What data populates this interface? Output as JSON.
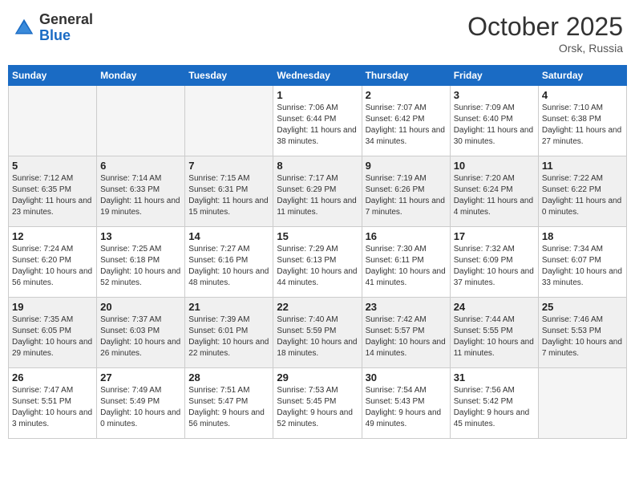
{
  "header": {
    "logo_general": "General",
    "logo_blue": "Blue",
    "month": "October 2025",
    "location": "Orsk, Russia"
  },
  "weekdays": [
    "Sunday",
    "Monday",
    "Tuesday",
    "Wednesday",
    "Thursday",
    "Friday",
    "Saturday"
  ],
  "weeks": [
    [
      {
        "day": "",
        "sunrise": "",
        "sunset": "",
        "daylight": "",
        "empty": true
      },
      {
        "day": "",
        "sunrise": "",
        "sunset": "",
        "daylight": "",
        "empty": true
      },
      {
        "day": "",
        "sunrise": "",
        "sunset": "",
        "daylight": "",
        "empty": true
      },
      {
        "day": "1",
        "sunrise": "Sunrise: 7:06 AM",
        "sunset": "Sunset: 6:44 PM",
        "daylight": "Daylight: 11 hours and 38 minutes."
      },
      {
        "day": "2",
        "sunrise": "Sunrise: 7:07 AM",
        "sunset": "Sunset: 6:42 PM",
        "daylight": "Daylight: 11 hours and 34 minutes."
      },
      {
        "day": "3",
        "sunrise": "Sunrise: 7:09 AM",
        "sunset": "Sunset: 6:40 PM",
        "daylight": "Daylight: 11 hours and 30 minutes."
      },
      {
        "day": "4",
        "sunrise": "Sunrise: 7:10 AM",
        "sunset": "Sunset: 6:38 PM",
        "daylight": "Daylight: 11 hours and 27 minutes."
      }
    ],
    [
      {
        "day": "5",
        "sunrise": "Sunrise: 7:12 AM",
        "sunset": "Sunset: 6:35 PM",
        "daylight": "Daylight: 11 hours and 23 minutes."
      },
      {
        "day": "6",
        "sunrise": "Sunrise: 7:14 AM",
        "sunset": "Sunset: 6:33 PM",
        "daylight": "Daylight: 11 hours and 19 minutes."
      },
      {
        "day": "7",
        "sunrise": "Sunrise: 7:15 AM",
        "sunset": "Sunset: 6:31 PM",
        "daylight": "Daylight: 11 hours and 15 minutes."
      },
      {
        "day": "8",
        "sunrise": "Sunrise: 7:17 AM",
        "sunset": "Sunset: 6:29 PM",
        "daylight": "Daylight: 11 hours and 11 minutes."
      },
      {
        "day": "9",
        "sunrise": "Sunrise: 7:19 AM",
        "sunset": "Sunset: 6:26 PM",
        "daylight": "Daylight: 11 hours and 7 minutes."
      },
      {
        "day": "10",
        "sunrise": "Sunrise: 7:20 AM",
        "sunset": "Sunset: 6:24 PM",
        "daylight": "Daylight: 11 hours and 4 minutes."
      },
      {
        "day": "11",
        "sunrise": "Sunrise: 7:22 AM",
        "sunset": "Sunset: 6:22 PM",
        "daylight": "Daylight: 11 hours and 0 minutes."
      }
    ],
    [
      {
        "day": "12",
        "sunrise": "Sunrise: 7:24 AM",
        "sunset": "Sunset: 6:20 PM",
        "daylight": "Daylight: 10 hours and 56 minutes."
      },
      {
        "day": "13",
        "sunrise": "Sunrise: 7:25 AM",
        "sunset": "Sunset: 6:18 PM",
        "daylight": "Daylight: 10 hours and 52 minutes."
      },
      {
        "day": "14",
        "sunrise": "Sunrise: 7:27 AM",
        "sunset": "Sunset: 6:16 PM",
        "daylight": "Daylight: 10 hours and 48 minutes."
      },
      {
        "day": "15",
        "sunrise": "Sunrise: 7:29 AM",
        "sunset": "Sunset: 6:13 PM",
        "daylight": "Daylight: 10 hours and 44 minutes."
      },
      {
        "day": "16",
        "sunrise": "Sunrise: 7:30 AM",
        "sunset": "Sunset: 6:11 PM",
        "daylight": "Daylight: 10 hours and 41 minutes."
      },
      {
        "day": "17",
        "sunrise": "Sunrise: 7:32 AM",
        "sunset": "Sunset: 6:09 PM",
        "daylight": "Daylight: 10 hours and 37 minutes."
      },
      {
        "day": "18",
        "sunrise": "Sunrise: 7:34 AM",
        "sunset": "Sunset: 6:07 PM",
        "daylight": "Daylight: 10 hours and 33 minutes."
      }
    ],
    [
      {
        "day": "19",
        "sunrise": "Sunrise: 7:35 AM",
        "sunset": "Sunset: 6:05 PM",
        "daylight": "Daylight: 10 hours and 29 minutes."
      },
      {
        "day": "20",
        "sunrise": "Sunrise: 7:37 AM",
        "sunset": "Sunset: 6:03 PM",
        "daylight": "Daylight: 10 hours and 26 minutes."
      },
      {
        "day": "21",
        "sunrise": "Sunrise: 7:39 AM",
        "sunset": "Sunset: 6:01 PM",
        "daylight": "Daylight: 10 hours and 22 minutes."
      },
      {
        "day": "22",
        "sunrise": "Sunrise: 7:40 AM",
        "sunset": "Sunset: 5:59 PM",
        "daylight": "Daylight: 10 hours and 18 minutes."
      },
      {
        "day": "23",
        "sunrise": "Sunrise: 7:42 AM",
        "sunset": "Sunset: 5:57 PM",
        "daylight": "Daylight: 10 hours and 14 minutes."
      },
      {
        "day": "24",
        "sunrise": "Sunrise: 7:44 AM",
        "sunset": "Sunset: 5:55 PM",
        "daylight": "Daylight: 10 hours and 11 minutes."
      },
      {
        "day": "25",
        "sunrise": "Sunrise: 7:46 AM",
        "sunset": "Sunset: 5:53 PM",
        "daylight": "Daylight: 10 hours and 7 minutes."
      }
    ],
    [
      {
        "day": "26",
        "sunrise": "Sunrise: 7:47 AM",
        "sunset": "Sunset: 5:51 PM",
        "daylight": "Daylight: 10 hours and 3 minutes."
      },
      {
        "day": "27",
        "sunrise": "Sunrise: 7:49 AM",
        "sunset": "Sunset: 5:49 PM",
        "daylight": "Daylight: 10 hours and 0 minutes."
      },
      {
        "day": "28",
        "sunrise": "Sunrise: 7:51 AM",
        "sunset": "Sunset: 5:47 PM",
        "daylight": "Daylight: 9 hours and 56 minutes."
      },
      {
        "day": "29",
        "sunrise": "Sunrise: 7:53 AM",
        "sunset": "Sunset: 5:45 PM",
        "daylight": "Daylight: 9 hours and 52 minutes."
      },
      {
        "day": "30",
        "sunrise": "Sunrise: 7:54 AM",
        "sunset": "Sunset: 5:43 PM",
        "daylight": "Daylight: 9 hours and 49 minutes."
      },
      {
        "day": "31",
        "sunrise": "Sunrise: 7:56 AM",
        "sunset": "Sunset: 5:42 PM",
        "daylight": "Daylight: 9 hours and 45 minutes."
      },
      {
        "day": "",
        "sunrise": "",
        "sunset": "",
        "daylight": "",
        "empty": true
      }
    ]
  ]
}
